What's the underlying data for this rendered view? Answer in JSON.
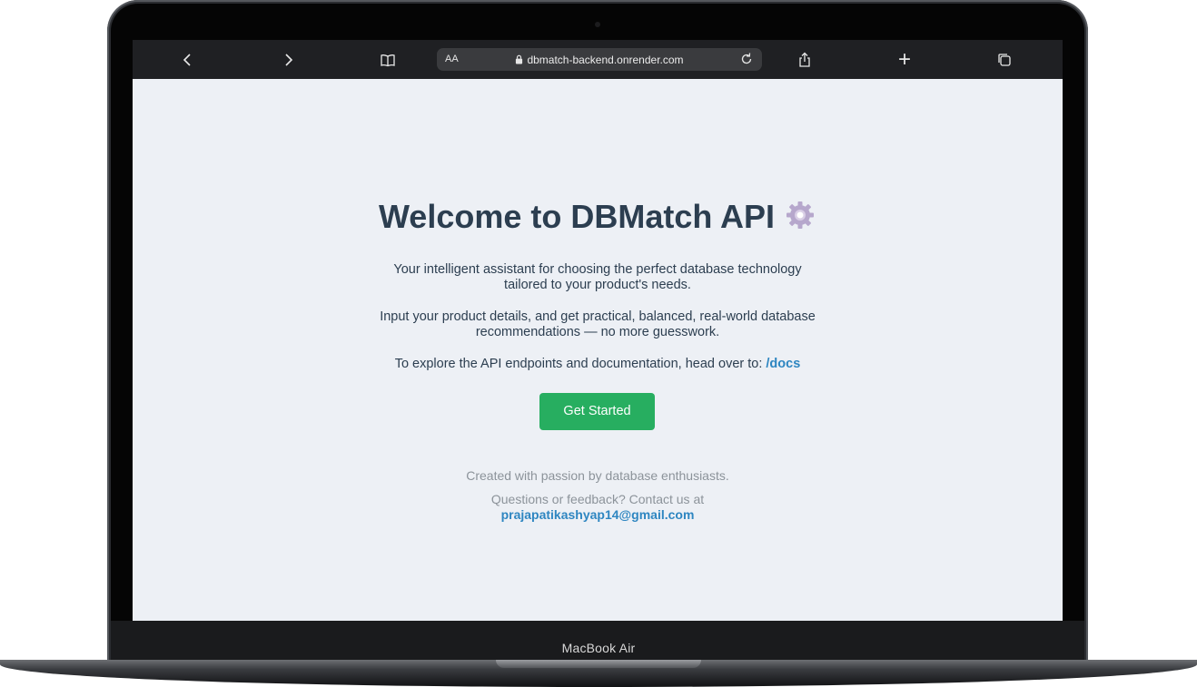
{
  "device": {
    "label": "MacBook Air"
  },
  "browser": {
    "back_icon": "chevron-left-icon",
    "forward_icon": "chevron-right-icon",
    "bookmarks_icon": "book-icon",
    "reader_label": "AA",
    "url": "dbmatch-backend.onrender.com",
    "lock_icon": "lock-icon",
    "reload_icon": "reload-icon",
    "share_icon": "share-icon",
    "new_tab_label": "+",
    "tabs_icon": "tabs-icon"
  },
  "page": {
    "title": "Welcome to DBMatch API",
    "title_icon": "gear-icon",
    "intro": "Your intelligent assistant for choosing the perfect database technology tailored to your product's needs.",
    "description": "Input your product details, and get practical, balanced, real-world database recommendations — no more guesswork.",
    "docs_prefix": "To explore the API endpoints and documentation, head over to:",
    "docs_link": "/docs",
    "cta_label": "Get Started",
    "footer_credit": "Created with passion by database enthusiasts.",
    "contact_prefix": "Questions or feedback? Contact us at",
    "contact_email": "prajapatikashyap14@gmail.com"
  },
  "colors": {
    "page_background": "#edf0f5",
    "heading": "#2c3e50",
    "link": "#2e86c1",
    "button": "#27ae60",
    "muted": "#8c939a",
    "toolbar": "#1f2023"
  }
}
